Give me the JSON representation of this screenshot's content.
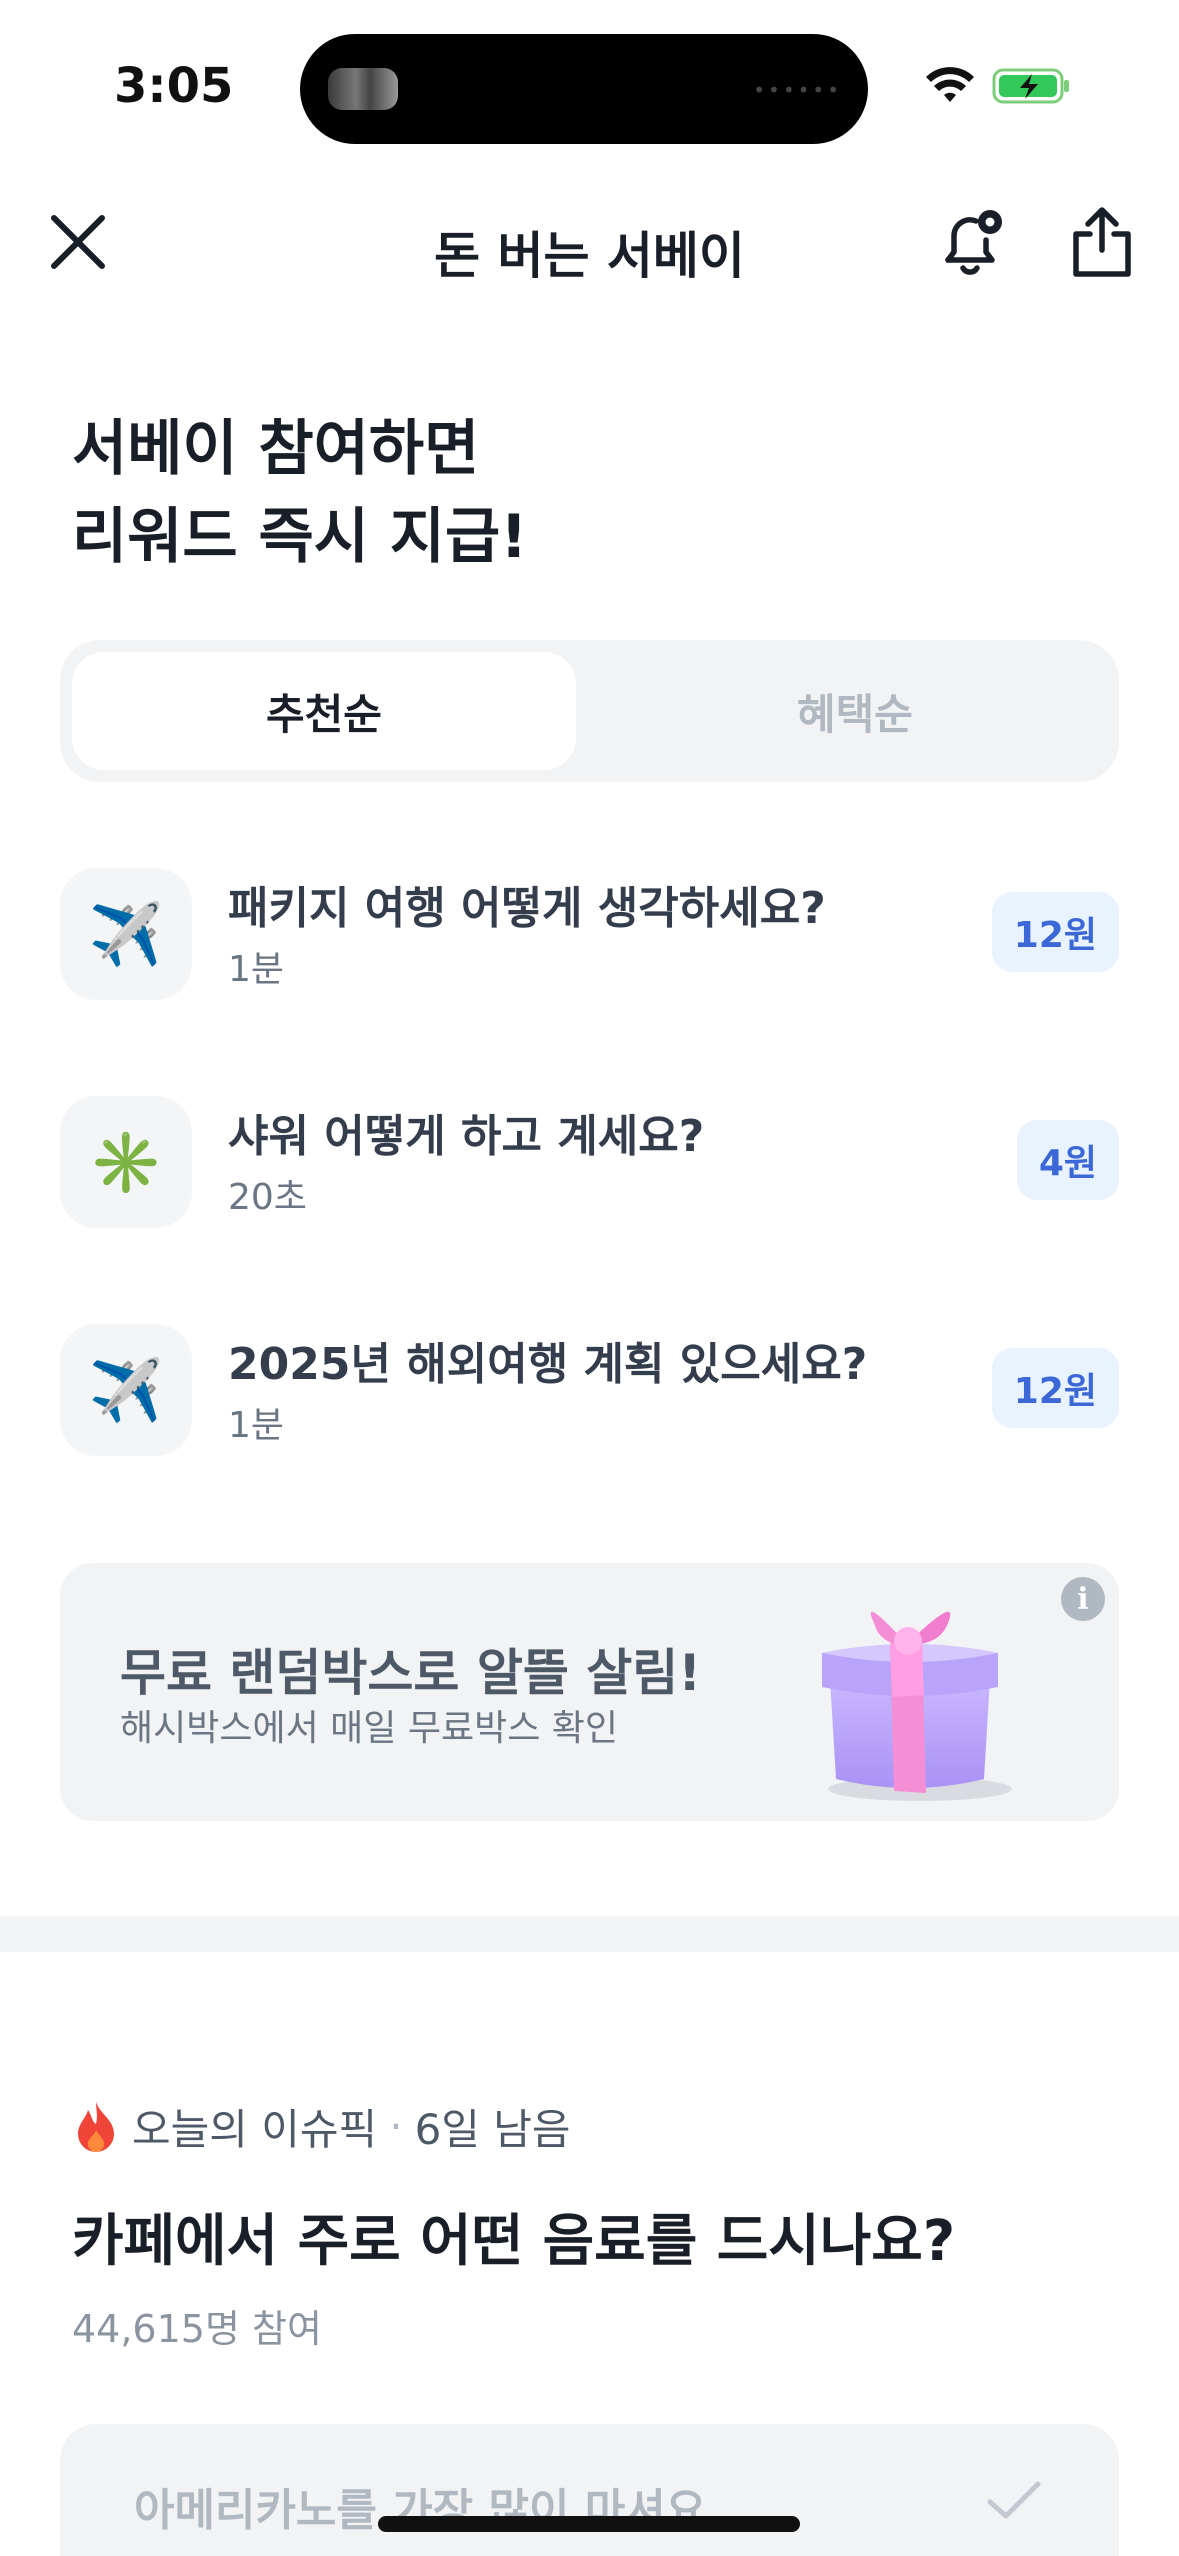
{
  "status_bar": {
    "time": "3:05"
  },
  "nav": {
    "title": "돈 버는 서베이"
  },
  "headline": {
    "line1": "서베이 참여하면",
    "line2": "리워드 즉시 지급!"
  },
  "tabs": [
    {
      "label": "추천순",
      "active": true
    },
    {
      "label": "혜택순",
      "active": false
    }
  ],
  "surveys": [
    {
      "icon": "airplane-icon",
      "glyph": "✈️",
      "title": "패키지 여행 어떻게 생각하세요?",
      "duration": "1분",
      "reward": "12원"
    },
    {
      "icon": "sparkle-icon",
      "glyph": "✳️",
      "title": "샤워 어떻게 하고 계세요?",
      "duration": "20초",
      "reward": "4원"
    },
    {
      "icon": "airplane-icon",
      "glyph": "✈️",
      "title": "2025년 해외여행 계획 있으세요?",
      "duration": "1분",
      "reward": "12원"
    }
  ],
  "banner": {
    "title": "무료 랜덤박스로 알뜰 살림!",
    "subtitle": "해시박스에서 매일 무료박스 확인",
    "info": "i"
  },
  "issue": {
    "label": "오늘의 이슈픽",
    "separator": "·",
    "remaining": "6일 남음",
    "question": "카페에서 주로 어떤 음료를 드시나요?",
    "participants": "44,615명 참여",
    "options": [
      {
        "text": "아메리카노를 가장 많이 마셔요"
      }
    ]
  },
  "colors": {
    "accent_blue": "#3c67d6",
    "reward_bg": "#e8f3ff",
    "card_bg": "#f2f3f5"
  }
}
